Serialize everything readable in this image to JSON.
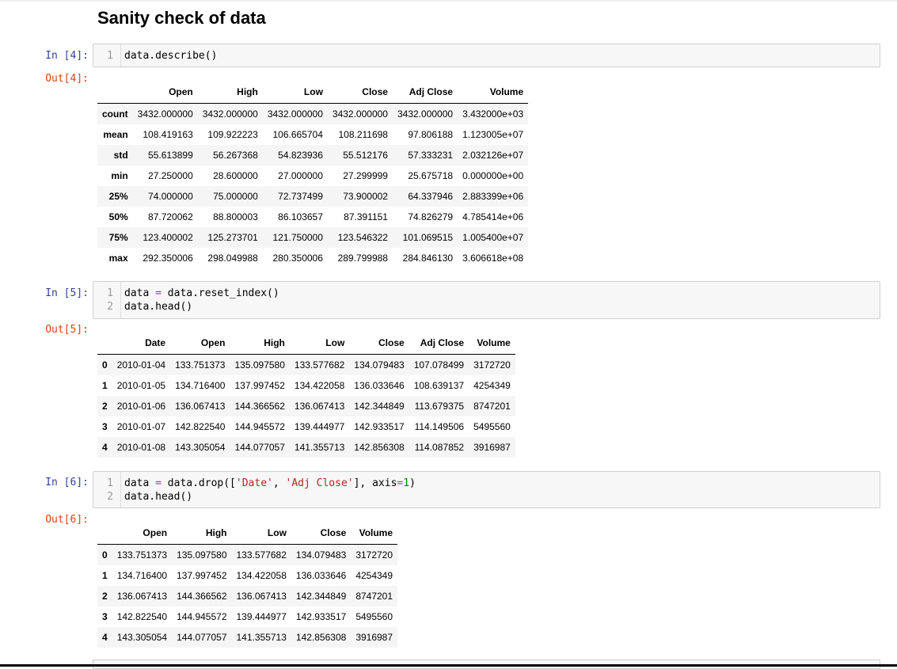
{
  "heading": "Sanity check of data",
  "cells": [
    {
      "in_prompt": "In [4]:",
      "out_prompt": "Out[4]:",
      "code_lines": [
        {
          "num": "1",
          "segments": [
            {
              "t": "data.describe()",
              "c": ""
            }
          ]
        }
      ],
      "table": {
        "columns": [
          "",
          "Open",
          "High",
          "Low",
          "Close",
          "Adj Close",
          "Volume"
        ],
        "rows": [
          [
            "count",
            "3432.000000",
            "3432.000000",
            "3432.000000",
            "3432.000000",
            "3432.000000",
            "3.432000e+03"
          ],
          [
            "mean",
            "108.419163",
            "109.922223",
            "106.665704",
            "108.211698",
            "97.806188",
            "1.123005e+07"
          ],
          [
            "std",
            "55.613899",
            "56.267368",
            "54.823936",
            "55.512176",
            "57.333231",
            "2.032126e+07"
          ],
          [
            "min",
            "27.250000",
            "28.600000",
            "27.000000",
            "27.299999",
            "25.675718",
            "0.000000e+00"
          ],
          [
            "25%",
            "74.000000",
            "75.000000",
            "72.737499",
            "73.900002",
            "64.337946",
            "2.883399e+06"
          ],
          [
            "50%",
            "87.720062",
            "88.800003",
            "86.103657",
            "87.391151",
            "74.826279",
            "4.785414e+06"
          ],
          [
            "75%",
            "123.400002",
            "125.273701",
            "121.750000",
            "123.546322",
            "101.069515",
            "1.005400e+07"
          ],
          [
            "max",
            "292.350006",
            "298.049988",
            "280.350006",
            "289.799988",
            "284.846130",
            "3.606618e+08"
          ]
        ]
      }
    },
    {
      "in_prompt": "In [5]:",
      "out_prompt": "Out[5]:",
      "code_lines": [
        {
          "num": "1",
          "segments": [
            {
              "t": "data ",
              "c": ""
            },
            {
              "t": "=",
              "c": "op"
            },
            {
              "t": " data.reset_index()",
              "c": ""
            }
          ]
        },
        {
          "num": "2",
          "segments": [
            {
              "t": "data.head()",
              "c": ""
            }
          ]
        }
      ],
      "table": {
        "columns": [
          "",
          "Date",
          "Open",
          "High",
          "Low",
          "Close",
          "Adj Close",
          "Volume"
        ],
        "rows": [
          [
            "0",
            "2010-01-04",
            "133.751373",
            "135.097580",
            "133.577682",
            "134.079483",
            "107.078499",
            "3172720"
          ],
          [
            "1",
            "2010-01-05",
            "134.716400",
            "137.997452",
            "134.422058",
            "136.033646",
            "108.639137",
            "4254349"
          ],
          [
            "2",
            "2010-01-06",
            "136.067413",
            "144.366562",
            "136.067413",
            "142.344849",
            "113.679375",
            "8747201"
          ],
          [
            "3",
            "2010-01-07",
            "142.822540",
            "144.945572",
            "139.444977",
            "142.933517",
            "114.149506",
            "5495560"
          ],
          [
            "4",
            "2010-01-08",
            "143.305054",
            "144.077057",
            "141.355713",
            "142.856308",
            "114.087852",
            "3916987"
          ]
        ]
      }
    },
    {
      "in_prompt": "In [6]:",
      "out_prompt": "Out[6]:",
      "code_lines": [
        {
          "num": "1",
          "segments": [
            {
              "t": "data ",
              "c": ""
            },
            {
              "t": "=",
              "c": "op"
            },
            {
              "t": " data.drop([",
              "c": ""
            },
            {
              "t": "'Date'",
              "c": "str"
            },
            {
              "t": ", ",
              "c": ""
            },
            {
              "t": "'Adj Close'",
              "c": "str"
            },
            {
              "t": "], axis",
              "c": ""
            },
            {
              "t": "=",
              "c": "op"
            },
            {
              "t": "1",
              "c": "num"
            },
            {
              "t": ")",
              "c": ""
            }
          ]
        },
        {
          "num": "2",
          "segments": [
            {
              "t": "data.head()",
              "c": ""
            }
          ]
        }
      ],
      "table": {
        "columns": [
          "",
          "Open",
          "High",
          "Low",
          "Close",
          "Volume"
        ],
        "rows": [
          [
            "0",
            "133.751373",
            "135.097580",
            "133.577682",
            "134.079483",
            "3172720"
          ],
          [
            "1",
            "134.716400",
            "137.997452",
            "134.422058",
            "136.033646",
            "4254349"
          ],
          [
            "2",
            "136.067413",
            "144.366562",
            "136.067413",
            "142.344849",
            "8747201"
          ],
          [
            "3",
            "142.822540",
            "144.945572",
            "139.444977",
            "142.933517",
            "5495560"
          ],
          [
            "4",
            "143.305054",
            "144.077057",
            "141.355713",
            "142.856308",
            "3916987"
          ]
        ]
      }
    }
  ]
}
